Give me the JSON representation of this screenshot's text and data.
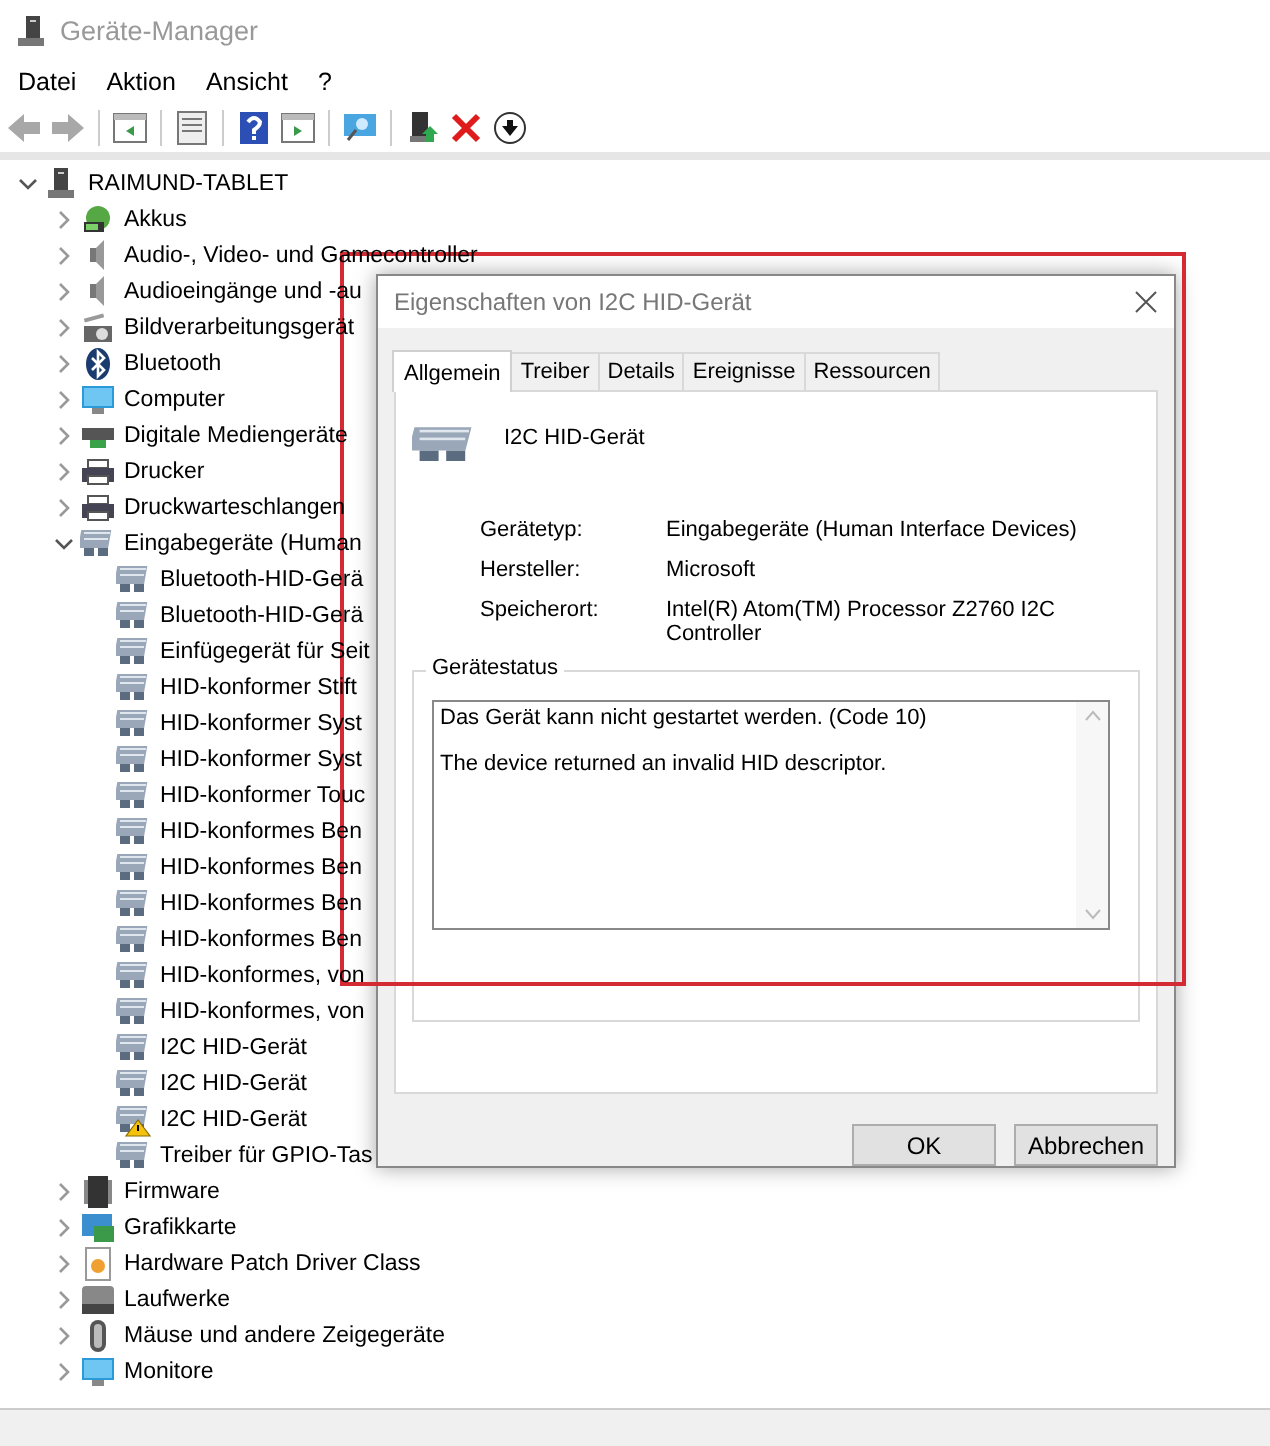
{
  "window": {
    "title": "Geräte-Manager"
  },
  "menu": [
    {
      "label": "Datei"
    },
    {
      "label": "Aktion"
    },
    {
      "label": "Ansicht"
    },
    {
      "label": "?"
    }
  ],
  "toolbar": [
    {
      "kind": "back"
    },
    {
      "kind": "forward"
    },
    {
      "kind": "sep"
    },
    {
      "kind": "tree-pane"
    },
    {
      "kind": "sep"
    },
    {
      "kind": "properties"
    },
    {
      "kind": "sep"
    },
    {
      "kind": "help"
    },
    {
      "kind": "action-pane"
    },
    {
      "kind": "sep"
    },
    {
      "kind": "scan"
    },
    {
      "kind": "sep"
    },
    {
      "kind": "update"
    },
    {
      "kind": "remove"
    },
    {
      "kind": "download"
    }
  ],
  "tree": {
    "label": "RAIMUND-TABLET",
    "kind": "computer",
    "expanded": true,
    "children": [
      {
        "label": "Akkus",
        "kind": "battery",
        "expanded": false
      },
      {
        "label": "Audio-, Video- und Gamecontroller",
        "kind": "speaker",
        "expanded": false
      },
      {
        "label": "Audioeingänge und -au",
        "kind": "speaker",
        "expanded": false
      },
      {
        "label": "Bildverarbeitungsgerät",
        "kind": "camera",
        "expanded": false
      },
      {
        "label": "Bluetooth",
        "kind": "bluetooth",
        "expanded": false
      },
      {
        "label": "Computer",
        "kind": "monitor",
        "expanded": false
      },
      {
        "label": "Digitale Mediengeräte",
        "kind": "media",
        "expanded": false
      },
      {
        "label": "Drucker",
        "kind": "printer",
        "expanded": false
      },
      {
        "label": "Druckwarteschlangen",
        "kind": "printer",
        "expanded": false
      },
      {
        "label": "Eingabegeräte (Human",
        "kind": "hid",
        "expanded": true,
        "children": [
          {
            "label": "Bluetooth-HID-Gerä",
            "kind": "hid",
            "warning": false
          },
          {
            "label": "Bluetooth-HID-Gerä",
            "kind": "hid",
            "warning": false
          },
          {
            "label": "Einfügegerät für Seit",
            "kind": "hid",
            "warning": false
          },
          {
            "label": "HID-konformer Stift",
            "kind": "hid",
            "warning": false
          },
          {
            "label": "HID-konformer Syst",
            "kind": "hid",
            "warning": false
          },
          {
            "label": "HID-konformer Syst",
            "kind": "hid",
            "warning": false
          },
          {
            "label": "HID-konformer Touc",
            "kind": "hid",
            "warning": false
          },
          {
            "label": "HID-konformes Ben",
            "kind": "hid",
            "warning": false
          },
          {
            "label": "HID-konformes Ben",
            "kind": "hid",
            "warning": false
          },
          {
            "label": "HID-konformes Ben",
            "kind": "hid",
            "warning": false
          },
          {
            "label": "HID-konformes Ben",
            "kind": "hid",
            "warning": false
          },
          {
            "label": "HID-konformes, von",
            "kind": "hid",
            "warning": false
          },
          {
            "label": "HID-konformes, von",
            "kind": "hid",
            "warning": false
          },
          {
            "label": "I2C HID-Gerät",
            "kind": "hid",
            "warning": false
          },
          {
            "label": "I2C HID-Gerät",
            "kind": "hid",
            "warning": false
          },
          {
            "label": "I2C HID-Gerät",
            "kind": "hid",
            "warning": true
          },
          {
            "label": "Treiber für GPIO-Tas",
            "kind": "hid",
            "warning": false
          }
        ]
      },
      {
        "label": "Firmware",
        "kind": "chip",
        "expanded": false
      },
      {
        "label": "Grafikkarte",
        "kind": "graphics",
        "expanded": false
      },
      {
        "label": "Hardware Patch Driver Class",
        "kind": "patch",
        "expanded": false
      },
      {
        "label": "Laufwerke",
        "kind": "drive",
        "expanded": false
      },
      {
        "label": "Mäuse und andere Zeigegeräte",
        "kind": "mouse",
        "expanded": false
      },
      {
        "label": "Monitore",
        "kind": "monitor",
        "expanded": false
      }
    ]
  },
  "dialog": {
    "title": "Eigenschaften von I2C HID-Gerät",
    "tabs": [
      {
        "label": "Allgemein",
        "selected": true
      },
      {
        "label": "Treiber",
        "selected": false
      },
      {
        "label": "Details",
        "selected": false
      },
      {
        "label": "Ereignisse",
        "selected": false
      },
      {
        "label": "Ressourcen",
        "selected": false
      }
    ],
    "device_name": "I2C HID-Gerät",
    "properties": [
      {
        "label": "Gerätetyp:",
        "value": "Eingabegeräte (Human Interface Devices)"
      },
      {
        "label": "Hersteller:",
        "value": "Microsoft"
      },
      {
        "label": "Speicherort:",
        "value": "Intel(R) Atom(TM) Processor Z2760 I2C Controller"
      }
    ],
    "status": {
      "title": "Gerätestatus",
      "lines": [
        "Das Gerät kann nicht gestartet werden. (Code 10)",
        "The device returned an invalid HID descriptor."
      ]
    },
    "buttons": [
      {
        "label": "OK"
      },
      {
        "label": "Abbrechen"
      }
    ]
  }
}
